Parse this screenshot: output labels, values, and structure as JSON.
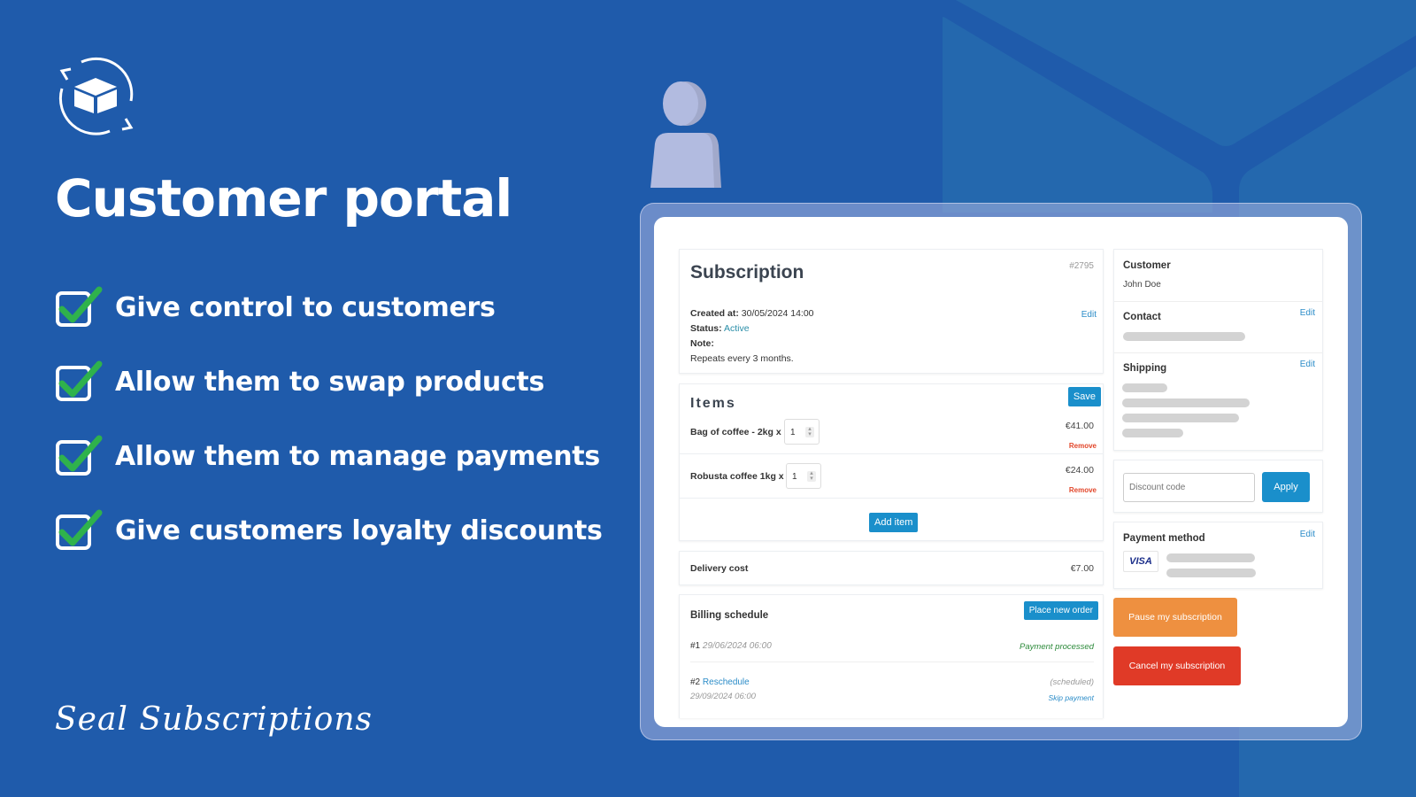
{
  "marketing": {
    "headline": "Customer portal",
    "features": [
      "Give control to customers",
      "Allow them to swap products",
      "Allow them to manage payments",
      "Give customers loyalty discounts"
    ],
    "brand": "Seal Subscriptions",
    "colors": {
      "background": "#1f5bab",
      "check": "#2fb24c"
    }
  },
  "subscription": {
    "title": "Subscription",
    "id": "#2795",
    "edit_label": "Edit",
    "created_label": "Created at:",
    "created_value": "30/05/2024 14:00",
    "status_label": "Status:",
    "status_value": "Active",
    "note_label": "Note:",
    "repeat_text": "Repeats every 3 months."
  },
  "items": {
    "title": "Items",
    "save_label": "Save",
    "rows": [
      {
        "name": "Bag of coffee - 2kg x",
        "qty": "1",
        "price": "€41.00",
        "remove_label": "Remove"
      },
      {
        "name": "Robusta coffee 1kg x",
        "qty": "1",
        "price": "€24.00",
        "remove_label": "Remove"
      }
    ],
    "add_label": "Add item"
  },
  "delivery": {
    "label": "Delivery cost",
    "value": "€7.00"
  },
  "billing": {
    "title": "Billing schedule",
    "place_order_label": "Place new order",
    "entries": [
      {
        "num": "#1",
        "date": "29/06/2024 06:00",
        "status": "Payment processed"
      },
      {
        "num": "#2",
        "link": "Reschedule",
        "date": "29/09/2024 06:00",
        "status": "(scheduled)",
        "action": "Skip payment"
      }
    ]
  },
  "sidebar": {
    "customer_label": "Customer",
    "customer_name": "John Doe",
    "contact_label": "Contact",
    "shipping_label": "Shipping",
    "edit_label": "Edit",
    "discount_placeholder": "Discount code",
    "apply_label": "Apply",
    "payment_label": "Payment method",
    "card_brand": "VISA",
    "pause_label": "Pause my subscription",
    "cancel_label": "Cancel my subscription"
  }
}
